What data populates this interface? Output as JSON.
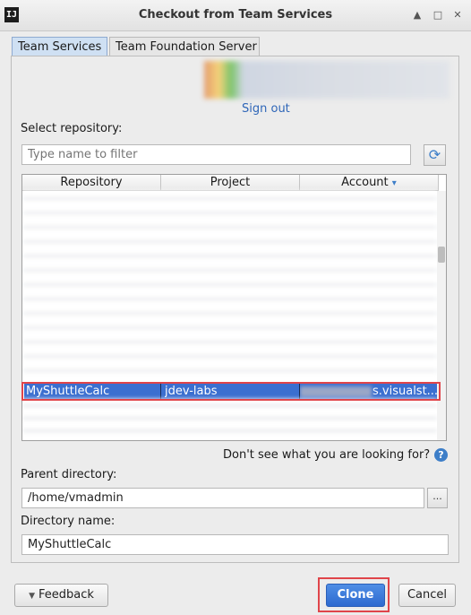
{
  "window": {
    "title": "Checkout from Team Services",
    "app_icon_text": "IJ",
    "controls": [
      "▲",
      "□",
      "✕"
    ]
  },
  "tabs": [
    {
      "label": "Team Services",
      "active": true
    },
    {
      "label": "Team Foundation Server",
      "active": false
    }
  ],
  "account": {
    "sign_out_label": "Sign out"
  },
  "repository": {
    "select_label": "Select repository:",
    "filter_placeholder": "Type name to filter",
    "columns": [
      "Repository",
      "Project",
      "Account"
    ],
    "sort_indicator": "▾",
    "selected_row": {
      "repository": "MyShuttleCalc",
      "project": "jdev-labs",
      "account_suffix": "s.visualst..."
    },
    "help_text": "Don't see what you are looking for?",
    "help_icon_text": "?"
  },
  "parent_directory": {
    "label": "Parent directory:",
    "value": "/home/vmadmin",
    "browse_label": "..."
  },
  "directory_name": {
    "label": "Directory name:",
    "value": "MyShuttleCalc"
  },
  "footer": {
    "feedback_label": "Feedback",
    "feedback_icon": "▼",
    "clone_label": "Clone",
    "cancel_label": "Cancel"
  },
  "colors": {
    "selection": "#3b6fd0",
    "primary_button": "#2d6ad0",
    "highlight_outline": "#e0454a",
    "link": "#2f66b8"
  }
}
